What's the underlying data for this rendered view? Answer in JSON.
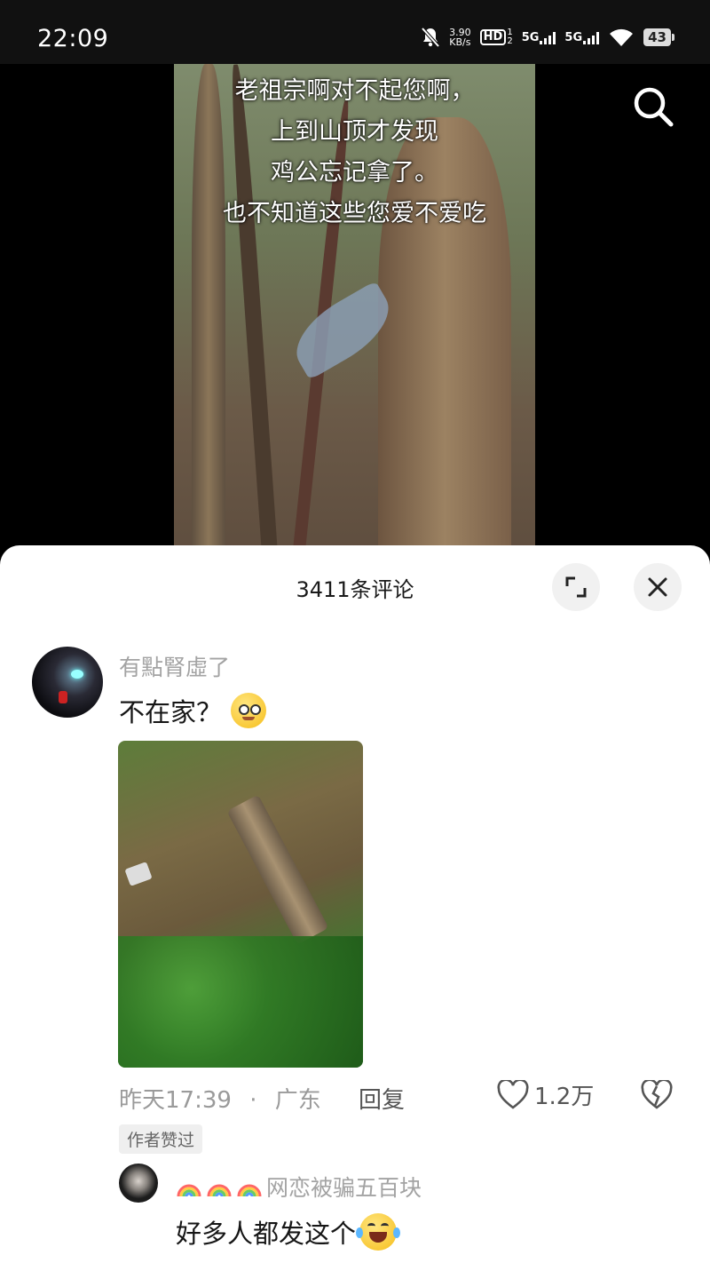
{
  "status_bar": {
    "time": "22:09",
    "speed_value": "3.90",
    "speed_unit": "KB/s",
    "hd_label": "HD",
    "sim_a": "1",
    "sim_b": "2",
    "net_a": "5G",
    "net_b": "5G",
    "battery": "43"
  },
  "video": {
    "caption_lines": [
      "老祖宗啊对不起您啊，",
      "上到山顶才发现",
      "鸡公忘记拿了。",
      "也不知道这些您爱不爱吃"
    ]
  },
  "comments_panel": {
    "title": "3411条评论"
  },
  "comment": {
    "username": "有點腎虛了",
    "text": "不在家？",
    "timestamp": "昨天17:39",
    "separator": "·",
    "location": "广东",
    "reply_label": "回复",
    "like_count": "1.2万",
    "author_badge": "作者赞过"
  },
  "reply": {
    "username": "网恋被骗五百块",
    "text": "好多人都发这个"
  },
  "icons": {
    "search": "search-icon",
    "expand": "expand-icon",
    "close": "close-icon",
    "like": "heart-icon",
    "dislike": "broken-heart-icon"
  }
}
